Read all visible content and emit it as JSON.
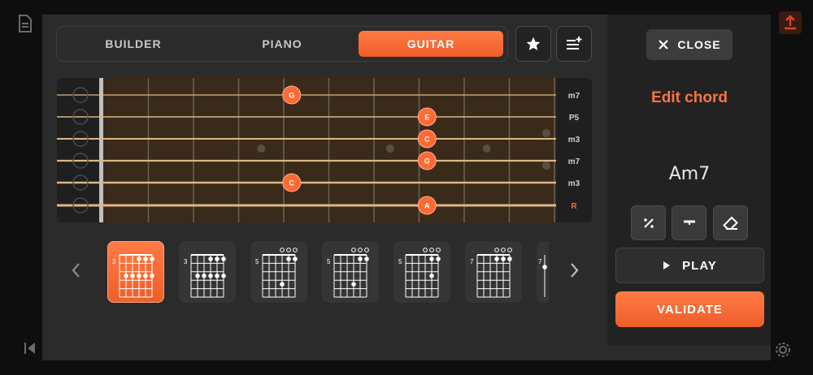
{
  "tabs": [
    {
      "label": "BUILDER",
      "active": false
    },
    {
      "label": "PIANO",
      "active": false
    },
    {
      "label": "GUITAR",
      "active": true
    }
  ],
  "icons": {
    "favorite": "star-icon",
    "list": "playlist-add-icon",
    "close": "close-icon",
    "background_doc": "document-icon",
    "background_upload": "upload-icon",
    "background_prev": "skip-previous-icon",
    "background_settings": "gear-icon"
  },
  "colors": {
    "accent": "#ff6a34",
    "root_label": "#ff6a34",
    "fretboard": "#3a2a1a",
    "string": "#d9b886"
  },
  "fretboard": {
    "interval_labels": [
      "m7",
      "P5",
      "m3",
      "m7",
      "m3",
      "R"
    ],
    "notes": [
      {
        "string": 0,
        "fret": 5,
        "label": "G"
      },
      {
        "string": 1,
        "fret": 8,
        "label": "E"
      },
      {
        "string": 2,
        "fret": 8,
        "label": "C"
      },
      {
        "string": 3,
        "fret": 8,
        "label": "G"
      },
      {
        "string": 4,
        "fret": 5,
        "label": "C"
      },
      {
        "string": 5,
        "fret": 8,
        "label": "A"
      }
    ]
  },
  "chord_diagrams": [
    {
      "fret_label": "3",
      "selected": true,
      "open": [
        false,
        false,
        false,
        false,
        false,
        false
      ]
    },
    {
      "fret_label": "3",
      "selected": false,
      "open": [
        false,
        false,
        false,
        false,
        false,
        false
      ]
    },
    {
      "fret_label": "5",
      "selected": false,
      "open": [
        false,
        false,
        false,
        true,
        true,
        true
      ]
    },
    {
      "fret_label": "5",
      "selected": false,
      "open": [
        false,
        false,
        false,
        true,
        true,
        true
      ]
    },
    {
      "fret_label": "5",
      "selected": false,
      "open": [
        false,
        false,
        false,
        true,
        true,
        true
      ]
    },
    {
      "fret_label": "7",
      "selected": false,
      "open": [
        false,
        false,
        false,
        true,
        true,
        true
      ]
    },
    {
      "fret_label": "7",
      "selected": false,
      "open": [
        false,
        false,
        false,
        true,
        true,
        true
      ]
    }
  ],
  "panel": {
    "close_label": "CLOSE",
    "title": "Edit chord",
    "chord_name": "Am7",
    "tools": [
      "percent-icon",
      "underscore-icon",
      "eraser-icon"
    ],
    "play_label": "PLAY",
    "validate_label": "VALIDATE"
  }
}
